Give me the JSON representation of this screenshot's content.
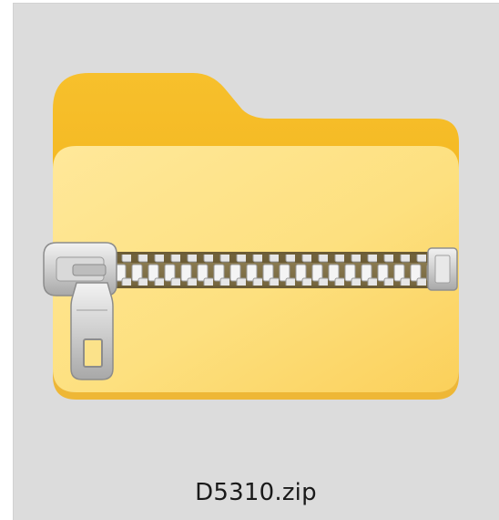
{
  "file": {
    "name": "D5310.zip",
    "icon": "zip-folder-icon"
  },
  "colors": {
    "tile_background": "#dcdcdc",
    "folder_back": "#f5b81c",
    "folder_front_light": "#ffe89a",
    "folder_front_dark": "#fac947",
    "zipper_metal": "#c8c8c8",
    "zipper_dark": "#8a8a8a"
  }
}
